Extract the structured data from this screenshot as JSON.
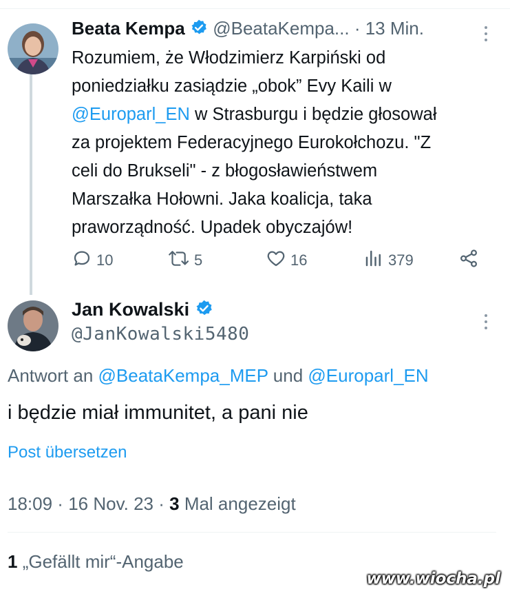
{
  "tweet1": {
    "display_name": "Beata Kempa",
    "handle": "@BeataKempa...",
    "separator": " · ",
    "time": "13 Min.",
    "body_lines": [
      "Rozumiem, że Włodzimierz Karpiński od",
      "poniedziałku zasiądzie „obok” Evy Kaili  w",
      "@Europarl_EN",
      " w Strasburgu i będzie głosował",
      "za projektem Federacyjnego Eurokołchozu. \"Z",
      "celi do Brukseli\" - z błogosławieństwem",
      "Marszałka Hołowni. Jaka koalicja, taka",
      "praworządność. Upadek obyczajów!"
    ],
    "replies": "10",
    "reposts": "5",
    "likes": "16",
    "views": "379"
  },
  "tweet2": {
    "display_name": "Jan Kowalski",
    "handle": "@JanKowalski5480",
    "reply_prefix": "Antwort an ",
    "reply_user1": "@BeataKempa_MEP",
    "reply_and": " und ",
    "reply_user2": "@Europarl_EN",
    "body": "i będzie miał immunitet, a pani nie",
    "translate": "Post übersetzen",
    "time": "18:09",
    "dot": " · ",
    "date": "16 Nov. 23",
    "views_count": "3",
    "views_label": " Mal angezeigt",
    "likes_count": "1",
    "likes_label": " „Gefällt mir“-Angabe"
  },
  "watermark": "www.wiocha.pl",
  "colors": {
    "accent": "#1d9bf0",
    "secondary_text": "#536471",
    "primary_text": "#0f1419"
  },
  "icons": [
    "verified-badge-icon",
    "more-icon",
    "reply-icon",
    "repost-icon",
    "like-icon",
    "views-icon",
    "share-icon"
  ]
}
